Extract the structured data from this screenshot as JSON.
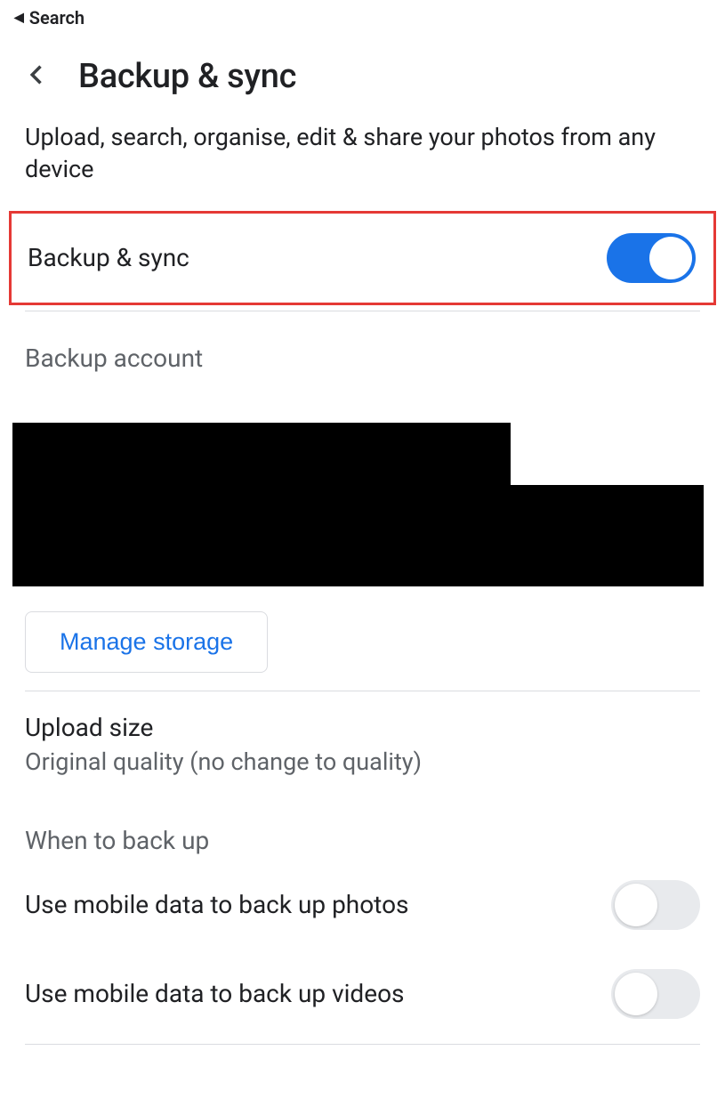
{
  "topNav": {
    "label": "Search"
  },
  "header": {
    "title": "Backup & sync"
  },
  "description": "Upload, search, organise, edit & share your photos from any device",
  "mainToggle": {
    "label": "Backup & sync",
    "on": true
  },
  "backupAccount": {
    "header": "Backup account"
  },
  "manageStorage": {
    "label": "Manage storage"
  },
  "uploadSize": {
    "title": "Upload size",
    "subtitle": "Original quality (no change to quality)"
  },
  "whenToBackUp": {
    "header": "When to back up",
    "photosRow": {
      "label": "Use mobile data to back up photos",
      "on": false
    },
    "videosRow": {
      "label": "Use mobile data to back up videos",
      "on": false
    }
  }
}
